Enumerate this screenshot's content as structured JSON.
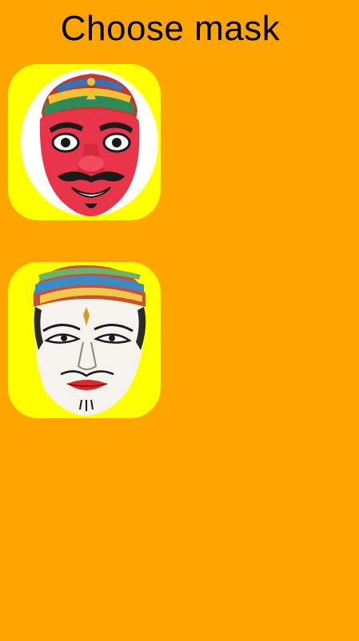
{
  "screen": {
    "title": "Choose mask",
    "background_color": "#FFA500",
    "card_color": "#FFFF00"
  },
  "masks": [
    {
      "icon": "red-mask-icon",
      "color": "#E8354A"
    },
    {
      "icon": "white-mask-icon",
      "color": "#F5F3EE"
    }
  ]
}
